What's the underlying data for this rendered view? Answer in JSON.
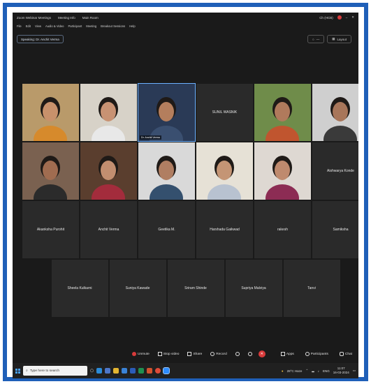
{
  "window": {
    "title": "Zoom Webinar Meetings",
    "meeting_info": "Meeting Info",
    "view": "Main Room",
    "right_text": "Ch (HCB)"
  },
  "menu": [
    "File",
    "Edit",
    "View",
    "Audio & Video",
    "Participant",
    "Meeting",
    "Breakout Sessions",
    "Help"
  ],
  "speaker_chip": "Speaking: Dr. Anchit Verma",
  "view_controls": {
    "layout": "Layout"
  },
  "tiles": [
    {
      "label": "",
      "video": true,
      "skin": "#c8916b",
      "bg": "#b99a6a",
      "shirt": "#d68a2c"
    },
    {
      "label": "",
      "video": true,
      "skin": "#c89273",
      "bg": "#d7d2c8",
      "shirt": "#e8e8e8"
    },
    {
      "label": "Dr. Anchit Verma",
      "video": true,
      "skin": "#b47e5d",
      "bg": "#2a3a56",
      "shirt": "#3a4f70",
      "active": true
    },
    {
      "label": "SUNIL WASNIK",
      "video": false
    },
    {
      "label": "",
      "video": true,
      "skin": "#b07a5c",
      "bg": "#6f8c4a",
      "shirt": "#c0552f"
    },
    {
      "label": "",
      "video": true,
      "skin": "#a8765a",
      "bg": "#cfcfcf",
      "shirt": "#3a3a3a"
    },
    {
      "label": "",
      "video": true,
      "skin": "#a06c50",
      "bg": "#7a6150",
      "shirt": "#2b2b2b"
    },
    {
      "label": "",
      "video": true,
      "skin": "#c28e70",
      "bg": "#5a3e2e",
      "shirt": "#a32c3c"
    },
    {
      "label": "",
      "video": true,
      "skin": "#b07e62",
      "bg": "#d9d9d9",
      "shirt": "#34506e"
    },
    {
      "label": "",
      "video": true,
      "skin": "#c49575",
      "bg": "#e6e1d6",
      "shirt": "#b8c2d0"
    },
    {
      "label": "",
      "video": true,
      "skin": "#bf8a6e",
      "bg": "#ded8d2",
      "shirt": "#8c2c54"
    },
    {
      "label": "Aishwarya Konde",
      "video": false
    },
    {
      "label": "Akanksha Purohit",
      "video": false
    },
    {
      "label": "Anchit Verma",
      "video": false
    },
    {
      "label": "Geetika M.",
      "video": false
    },
    {
      "label": "Harshada Gaikwad",
      "video": false
    },
    {
      "label": "rakesh",
      "video": false
    },
    {
      "label": "Samiksha",
      "video": false
    },
    {
      "label": "Sheela Kulkarni",
      "video": false
    },
    {
      "label": "Suniya Kawade",
      "video": false
    },
    {
      "label": "Sriram Shinde",
      "video": false
    },
    {
      "label": "Supriya Malviya",
      "video": false
    },
    {
      "label": "Tanvi",
      "video": false
    }
  ],
  "toolbar": {
    "unmute": "Unmute",
    "stop_video": "Stop video",
    "share": "Share",
    "record": "Record",
    "apps": "Apps",
    "participants": "Participants",
    "chat": "Chat"
  },
  "taskbar": {
    "search_placeholder": "Type here to search",
    "weather": "28°C Haze",
    "lang": "ENG",
    "time": "11:07",
    "date": "16-03-2024"
  }
}
